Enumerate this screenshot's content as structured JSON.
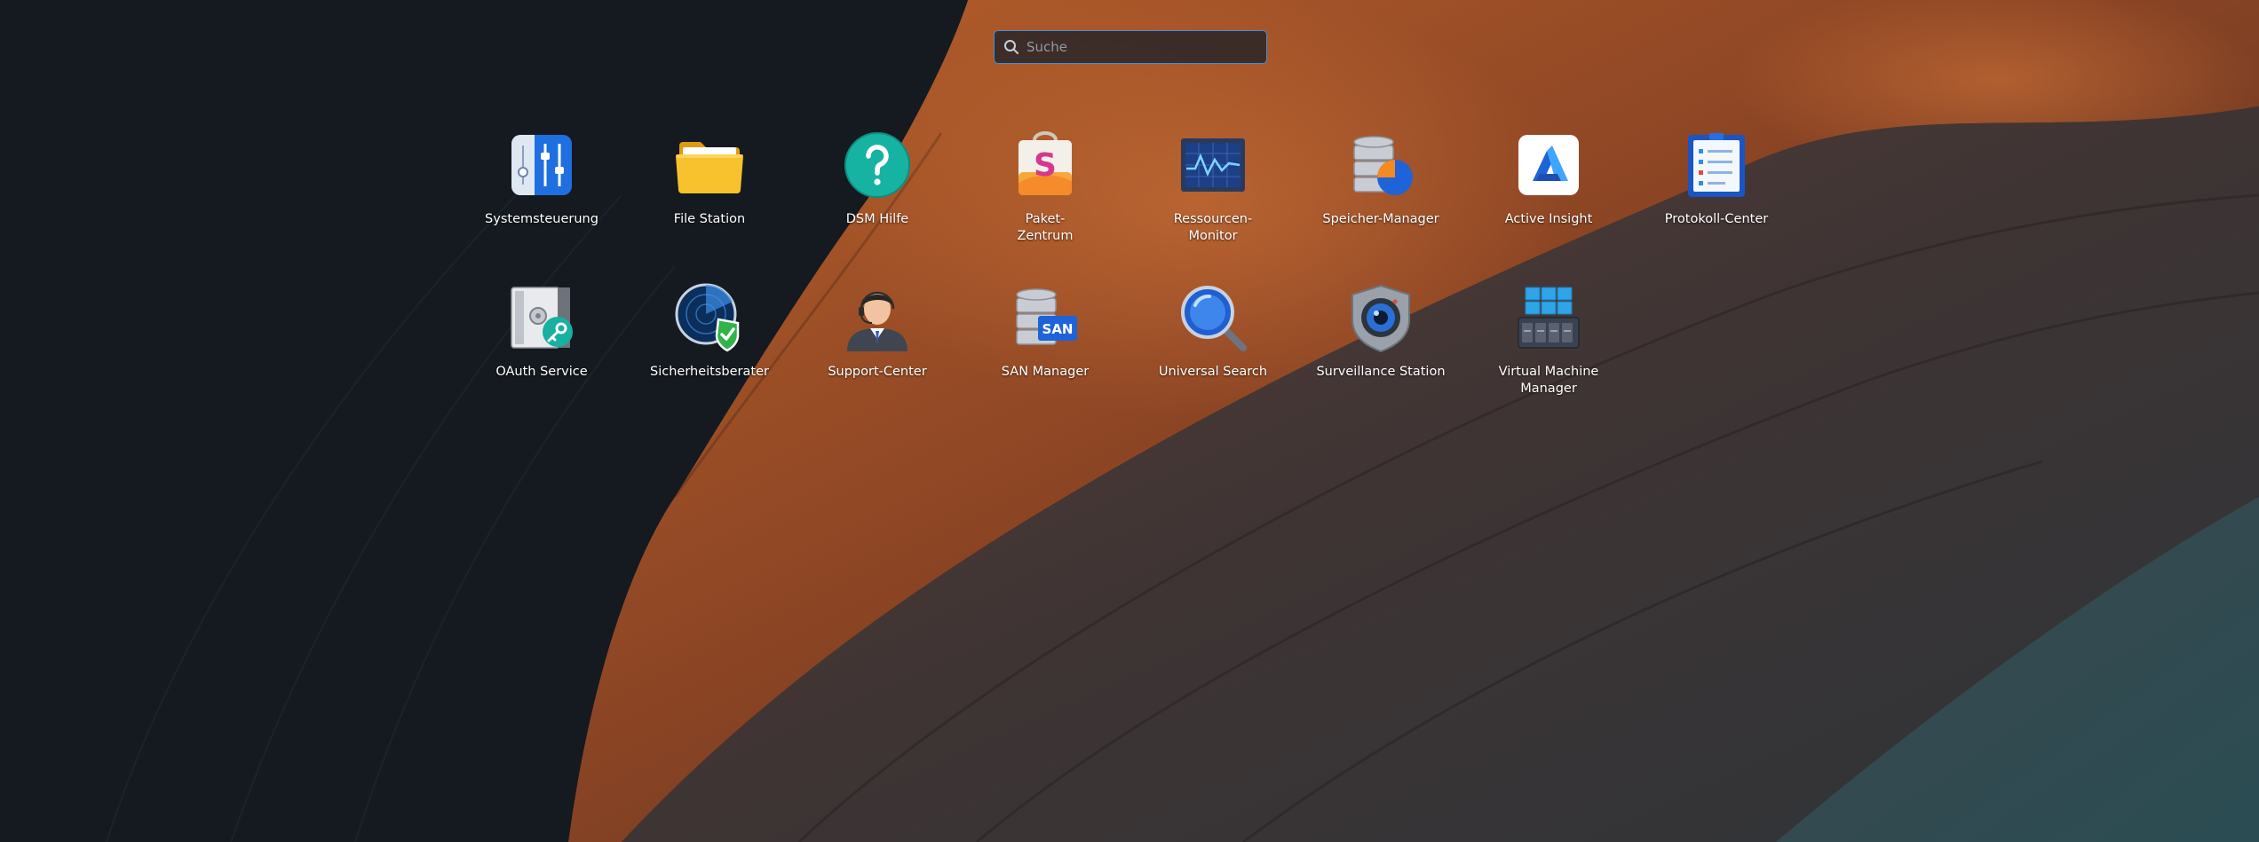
{
  "search": {
    "placeholder": "Suche",
    "value": ""
  },
  "apps": [
    {
      "label": "Systemsteuerung",
      "icon": "control-panel-icon"
    },
    {
      "label": "File Station",
      "icon": "folder-icon"
    },
    {
      "label": "DSM Hilfe",
      "icon": "help-question-icon"
    },
    {
      "label": "Paket-\nZentrum",
      "icon": "package-center-icon"
    },
    {
      "label": "Ressourcen-\nMonitor",
      "icon": "resource-monitor-icon"
    },
    {
      "label": "Speicher-Manager",
      "icon": "storage-manager-icon"
    },
    {
      "label": "Active Insight",
      "icon": "active-insight-icon"
    },
    {
      "label": "Protokoll-Center",
      "icon": "log-center-icon"
    },
    {
      "label": "OAuth Service",
      "icon": "oauth-safe-icon"
    },
    {
      "label": "Sicherheitsberater",
      "icon": "security-advisor-icon"
    },
    {
      "label": "Support-Center",
      "icon": "support-agent-icon"
    },
    {
      "label": "SAN Manager",
      "icon": "san-manager-icon",
      "badge": "SAN"
    },
    {
      "label": "Universal Search",
      "icon": "universal-search-icon"
    },
    {
      "label": "Surveillance Station",
      "icon": "surveillance-camera-icon"
    },
    {
      "label": "Virtual Machine\nManager",
      "icon": "virtual-machine-icon"
    }
  ]
}
